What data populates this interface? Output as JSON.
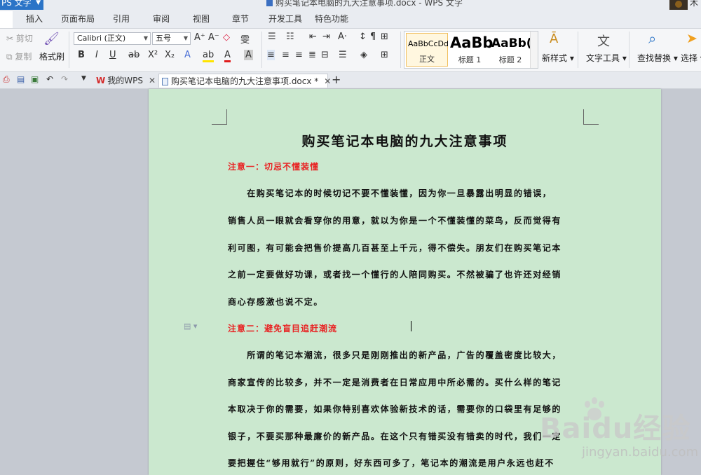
{
  "titlebar": {
    "app_button": "PS 文字",
    "doc_title": "购买笔记本电脑的九大注意事项.docx  -  WPS 文字",
    "user": "木"
  },
  "menu": {
    "tabs": [
      "插入",
      "页面布局",
      "引用",
      "审阅",
      "视图",
      "章节",
      "开发工具",
      "特色功能"
    ]
  },
  "ribbon": {
    "cut": "剪切",
    "copy": "复制",
    "format_painter": "格式刷",
    "font_name": "Calibri (正文)",
    "font_size": "五号",
    "bold": "B",
    "italic": "I",
    "underline": "U",
    "styles": [
      {
        "sample": "AaBbCcDd",
        "caption": "正文"
      },
      {
        "sample": "AaBb",
        "caption": "标题 1"
      },
      {
        "sample": "AaBb(",
        "caption": "标题 2"
      }
    ],
    "new_style": "新样式",
    "text_tools": "文字工具",
    "find_replace": "查找替换",
    "select": "选择"
  },
  "tabs": {
    "my_wps": "我的WPS",
    "document": "购买笔记本电脑的九大注意事项.docx *",
    "plus": "+"
  },
  "document": {
    "title": "购买笔记本电脑的九大注意事项",
    "heading1": "注意一：切忌不懂装懂",
    "para1": [
      "　　在购买笔记本的时候切记不要不懂装懂，因为你一旦暴露出明显的错误，",
      "销售人员一眼就会看穿你的用意，就以为你是一个不懂装懂的菜鸟，反而觉得有",
      "利可图，有可能会把售价提高几百甚至上千元，得不偿失。朋友们在购买笔记本",
      "之前一定要做好功课，或者找一个懂行的人陪同购买。不然被骗了也许还对经销",
      "商心存感激也说不定。"
    ],
    "heading2": "注意二：避免盲目追赶潮流",
    "para2": [
      "　　所谓的笔记本潮流，很多只是刚刚推出的新产品，广告的覆盖密度比较大，",
      "商家宣传的比较多，并不一定是消费者在日常应用中所必需的。买什么样的笔记",
      "本取决于你的需要，如果你特别喜欢体验新技术的话，需要你的口袋里有足够的",
      "银子，不要买那种最廉价的新产品。在这个只有错买没有错卖的时代，我们一定",
      "要把握住“够用就行”的原则，好东西可多了，笔记本的潮流是用户永远也赶不"
    ]
  },
  "watermark": {
    "brand": "Baidu经验",
    "url": "jingyan.baidu.com"
  }
}
